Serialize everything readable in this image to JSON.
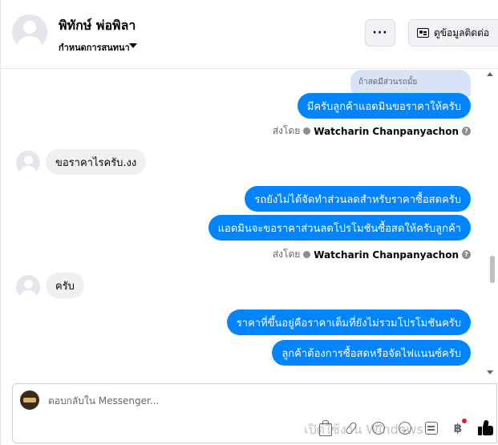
{
  "header": {
    "contact_name": "พิทักษ์ พ่อพิลา",
    "conversation_label": "กำหนดการสนทนา",
    "more_label": "···",
    "info_button_label": "ดูข้อมูลติดต่อ"
  },
  "messages": {
    "reply_quote": "ถ้าสดมีส่วนรถมั้ย",
    "out_1": "มีครับลูกค้าแอดมินขอราคาให้ครับ",
    "in_1": "ขอราคาไรครับ.งง",
    "out_2": "รถยังไม่ได้จัดทำส่วนลดสำหรับราคาซื้อสดครับ",
    "out_3": "แอดมินจะขอราคาส่วนลดโปรโมชันซื้อสดให้ครับลูกค้า",
    "in_2": "ครับ",
    "out_4": "ราคาที่ขึ้นอยู่คือราคาเต็มที่ยังไม่รวมโปรโมชันครับ",
    "out_5": "ลูกค้าต้องการซื้อสดหรือจัดไฟแนนซ์ครับ"
  },
  "sent_by": {
    "prefix": "ส่งโดย",
    "name": "Watcharin Chanpanyachon",
    "help_glyph": "?"
  },
  "composer": {
    "placeholder": "ตอบกลับใน Messenger...",
    "baht_glyph": "฿"
  },
  "watermark": "เปิดใช้งาน Windows"
}
